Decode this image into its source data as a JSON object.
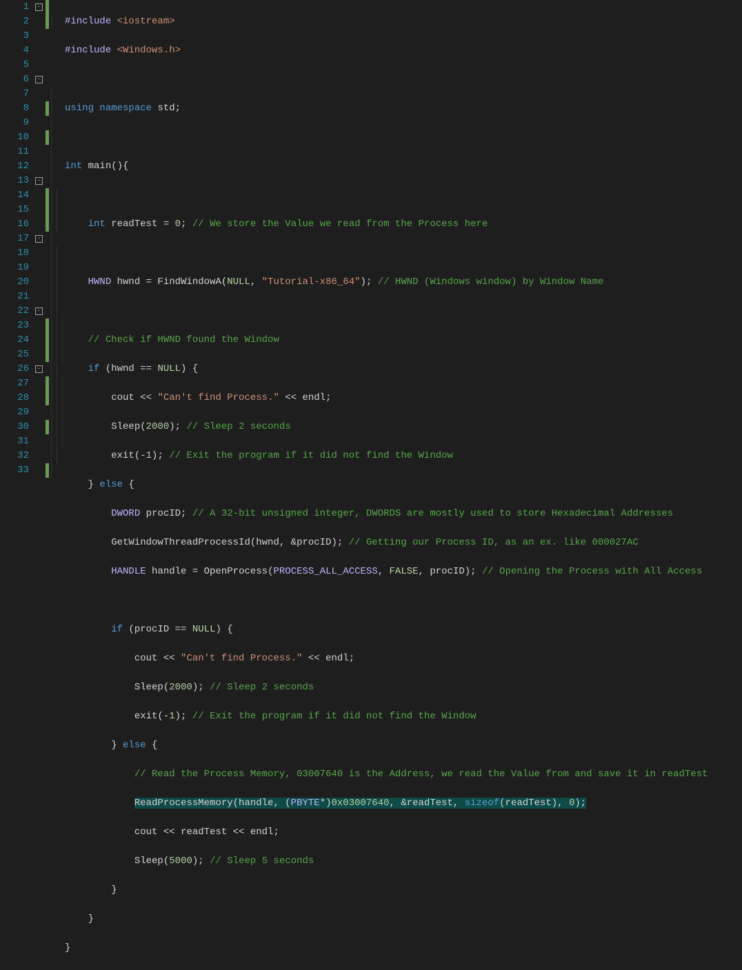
{
  "gutter": {
    "start": 1,
    "end": 33
  },
  "foldMarkers": [
    {
      "line": 1,
      "symbol": "-"
    },
    {
      "line": 6,
      "symbol": "-"
    },
    {
      "line": 13,
      "symbol": "-"
    },
    {
      "line": 17,
      "symbol": "-"
    },
    {
      "line": 22,
      "symbol": "-"
    },
    {
      "line": 26,
      "symbol": "-"
    }
  ],
  "changeBars": [
    {
      "from": 1,
      "to": 2
    },
    {
      "from": 8,
      "to": 8
    },
    {
      "from": 10,
      "to": 10
    },
    {
      "from": 14,
      "to": 16
    },
    {
      "from": 23,
      "to": 25
    },
    {
      "from": 27,
      "to": 28
    },
    {
      "from": 30,
      "to": 30
    },
    {
      "from": 33,
      "to": 33
    }
  ],
  "code": {
    "l1": {
      "t1": "#include",
      "t2": " <iostream>"
    },
    "l2": {
      "t1": "#include",
      "t2": " <Windows.h>"
    },
    "l4": {
      "t1": "using",
      "t2": " ",
      "t3": "namespace",
      "t4": " std;"
    },
    "l6": {
      "t1": "int",
      "t2": " main(){"
    },
    "l8": {
      "t1": "int",
      "t2": " readTest = ",
      "t3": "0",
      "t4": "; ",
      "t5": "// We store the Value we read from the Process here"
    },
    "l10": {
      "t1": "HWND",
      "t2": " hwnd = FindWindowA(",
      "t3": "NULL",
      "t4": ", ",
      "t5": "\"Tutorial-x86_64\"",
      "t6": "); ",
      "t7": "// HWND (Windows window) by Window Name"
    },
    "l12": "// Check if HWND found the Window",
    "l13": {
      "t1": "if",
      "t2": " (hwnd == ",
      "t3": "NULL",
      "t4": ") {"
    },
    "l14": {
      "t1": "cout << ",
      "t2": "\"Can't find Process.\"",
      "t3": " << endl;"
    },
    "l15": {
      "t1": "Sleep(",
      "t2": "2000",
      "t3": "); ",
      "t4": "// Sleep 2 seconds"
    },
    "l16": {
      "t1": "exit(-",
      "t2": "1",
      "t3": "); ",
      "t4": "// Exit the program if it did not find the Window"
    },
    "l17": {
      "t1": "} ",
      "t2": "else",
      "t3": " {"
    },
    "l18": {
      "t1": "DWORD",
      "t2": " procID; ",
      "t3": "// A 32-bit unsigned integer, DWORDS are mostly used to store Hexadecimal Addresses"
    },
    "l19": {
      "t1": "GetWindowThreadProcessId(hwnd, &procID); ",
      "t2": "// Getting our Process ID, as an ex. like 000027AC"
    },
    "l20": {
      "t1": "HANDLE",
      "t2": " handle = OpenProcess(",
      "t3": "PROCESS_ALL_ACCESS",
      "t4": ", ",
      "t5": "FALSE",
      "t6": ", procID); ",
      "t7": "// Opening the Process with All Access"
    },
    "l22": {
      "t1": "if",
      "t2": " (procID == ",
      "t3": "NULL",
      "t4": ") {"
    },
    "l23": {
      "t1": "cout << ",
      "t2": "\"Can't find Process.\"",
      "t3": " << endl;"
    },
    "l24": {
      "t1": "Sleep(",
      "t2": "2000",
      "t3": "); ",
      "t4": "// Sleep 2 seconds"
    },
    "l25": {
      "t1": "exit(-",
      "t2": "1",
      "t3": "); ",
      "t4": "// Exit the program if it did not find the Window"
    },
    "l26": {
      "t1": "} ",
      "t2": "else",
      "t3": " {"
    },
    "l27": "// Read the Process Memory, 03007640 is the Address, we read the Value from and save it in readTest",
    "l28": {
      "t1": "ReadProcessMemory(handle, (",
      "t2": "PBYTE",
      "t3": "*)",
      "t4": "0x03007640",
      "t5": ", &readTest, ",
      "t6": "sizeof",
      "t7": "(readTest), ",
      "t8": "0",
      "t9": ");"
    },
    "l29": "cout << readTest << endl;",
    "l30": {
      "t1": "Sleep(",
      "t2": "5000",
      "t3": "); ",
      "t4": "// Sleep 5 seconds"
    },
    "l31": "}",
    "l32": "}",
    "l33": "}"
  }
}
